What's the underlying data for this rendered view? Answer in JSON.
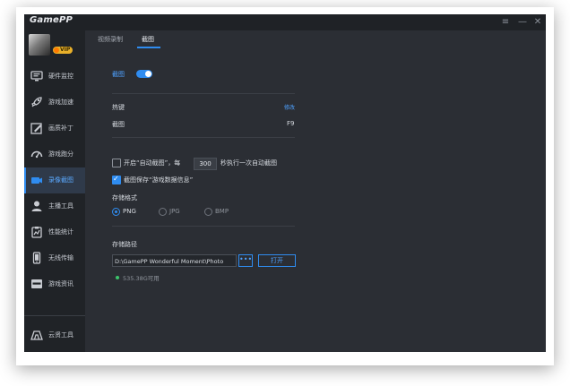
{
  "app": {
    "title": "GamePP"
  },
  "window_controls": {
    "menu": "≡",
    "minimize": "—",
    "close": "✕"
  },
  "user": {
    "badge": "VIP"
  },
  "sidebar": {
    "items": [
      {
        "label": "硬件监控",
        "icon": "monitor-icon"
      },
      {
        "label": "游戏加速",
        "icon": "rocket-icon"
      },
      {
        "label": "画质补丁",
        "icon": "brush-icon"
      },
      {
        "label": "游戏跑分",
        "icon": "speedometer-icon"
      },
      {
        "label": "录像截图",
        "icon": "camera-icon"
      },
      {
        "label": "主播工具",
        "icon": "streamer-icon"
      },
      {
        "label": "性能统计",
        "icon": "clipboard-chart-icon"
      },
      {
        "label": "无线传输",
        "icon": "phone-icon"
      },
      {
        "label": "游戏资讯",
        "icon": "news-icon"
      },
      {
        "label": "云贤工具",
        "icon": "cloud-tool-icon"
      }
    ]
  },
  "tabs": [
    {
      "label": "视频录制"
    },
    {
      "label": "截图"
    }
  ],
  "screenshot": {
    "enable_label": "截图",
    "hotkey": {
      "section_label": "热键",
      "modify_label": "修改",
      "action_label": "截图",
      "key": "F9"
    },
    "auto": {
      "prefix": "开启“自动截图”，每",
      "interval": "300",
      "suffix": "秒执行一次自动截图"
    },
    "save_info_label": "截图保存“游戏数据信息”",
    "format": {
      "section_label": "存储格式",
      "options": [
        "PNG",
        "JPG",
        "BMP"
      ]
    },
    "path": {
      "section_label": "存储路径",
      "value": "D:\\GamePP Wonderful Moment\\Photo",
      "browse_label": "•••",
      "open_label": "打开",
      "free_space": "535.38G可用"
    }
  }
}
